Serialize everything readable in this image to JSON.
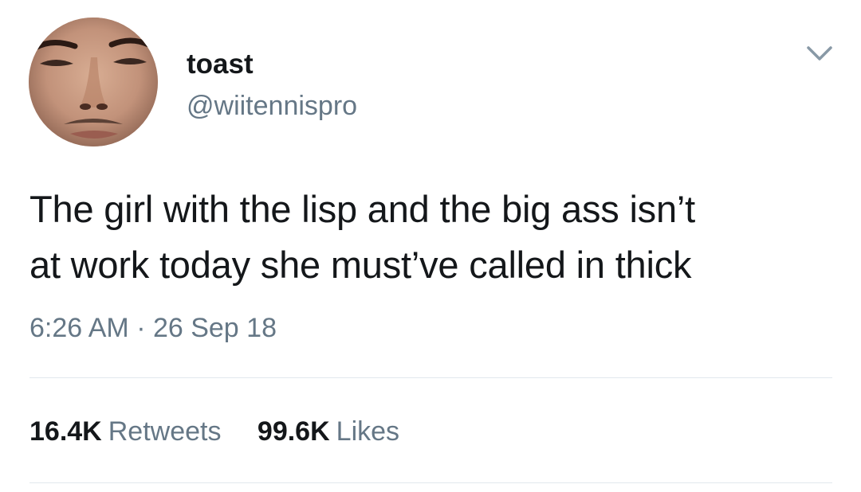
{
  "user": {
    "display_name": "toast",
    "handle": "@wiitennispro"
  },
  "tweet": {
    "line1": "The girl with the lisp and the big ass isn’t",
    "line2": "at work today she must’ve called in thick",
    "timestamp": "6:26 AM · 26 Sep 18"
  },
  "stats": {
    "retweets_count": "16.4K",
    "retweets_label": "Retweets",
    "likes_count": "99.6K",
    "likes_label": "Likes"
  },
  "icons": {
    "menu": "chevron-down-icon",
    "avatar": "profile-photo"
  },
  "colors": {
    "text": "#14171a",
    "secondary": "#657786",
    "divider": "#e1e8ed",
    "background": "#ffffff"
  }
}
